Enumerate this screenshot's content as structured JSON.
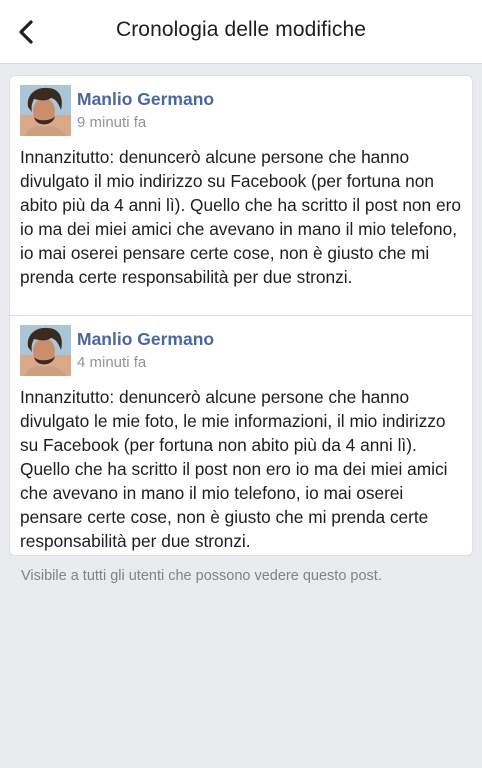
{
  "header": {
    "title": "Cronologia delle modifiche",
    "back_icon": "chevron-left-icon"
  },
  "entries": [
    {
      "author": "Manlio Germano",
      "time": "9 minuti fa",
      "text": "Innanzitutto: denuncerò alcune persone che hanno divulgato il mio indirizzo su Facebook (per fortuna non abito più da 4 anni lì). Quello che ha scritto il post non ero io ma dei miei amici che avevano in mano il mio telefono, io mai oserei pensare certe cose, non è giusto che mi prenda certe responsabilità per due stronzi."
    },
    {
      "author": "Manlio Germano",
      "time": "4 minuti fa",
      "text": "Innanzitutto: denuncerò alcune persone che hanno divulgato le mie foto, le mie informazioni, il mio indirizzo su Facebook (per fortuna non abito più da 4 anni lì). Quello che ha scritto il post non ero io ma dei miei amici che avevano in mano il mio telefono, io mai oserei pensare certe cose, non è giusto che mi prenda certe responsabilità per due stronzi."
    }
  ],
  "footer": {
    "visibility": "Visibile a tutti gli utenti che possono vedere questo post."
  },
  "colors": {
    "author_name": "#4b67a1",
    "timestamp": "#90949c",
    "background": "#e9ebee"
  }
}
